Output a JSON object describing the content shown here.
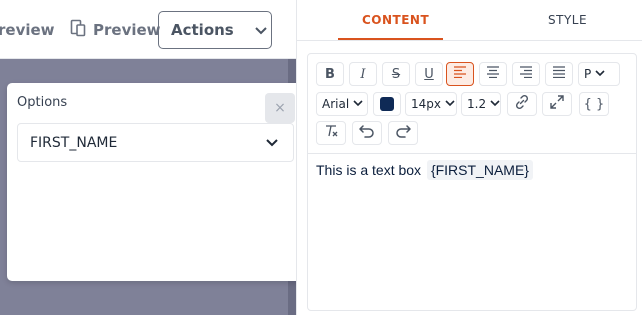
{
  "top_toolbar": {
    "preview_partial": "review",
    "preview_button": "Preview",
    "actions_button": "Actions"
  },
  "options_panel": {
    "title": "Options",
    "close_symbol": "×",
    "selected_value": "FIRST_NAME"
  },
  "right_panel": {
    "tabs": [
      {
        "label": "CONTENT",
        "active": true
      },
      {
        "label": "STYLE",
        "active": false
      }
    ],
    "toolbar": {
      "bold": "B",
      "italic": "I",
      "strike": "S",
      "underline": "U",
      "paragraph_select": "P",
      "font_select": "Arial",
      "text_color": "#0f2a56",
      "font_size_select": "14px",
      "line_height_select": "1.2",
      "code_label": "{ }"
    },
    "content": {
      "text": "This is a text box",
      "variable": "{FIRST_NAME}"
    }
  },
  "colors": {
    "accent": "#d9531e",
    "overlay": "#7f8198"
  }
}
